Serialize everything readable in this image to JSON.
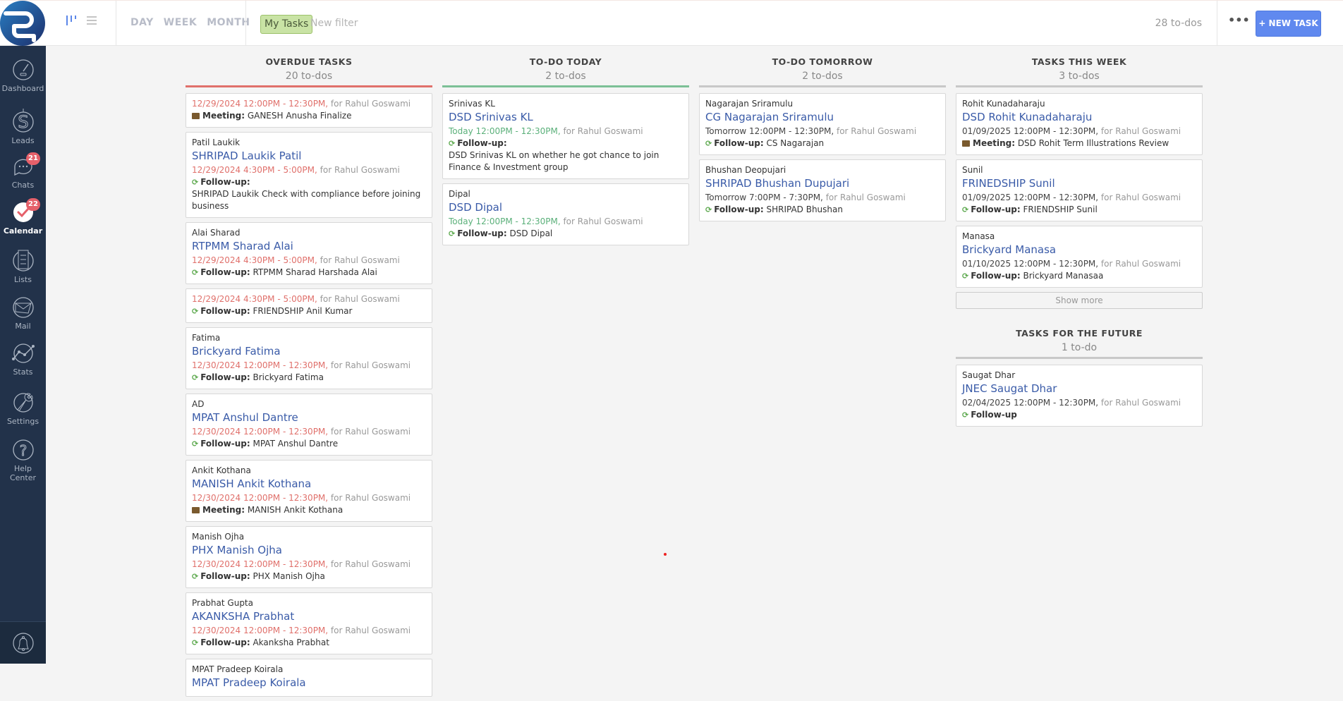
{
  "topbar": {
    "period_tabs": [
      "DAY",
      "WEEK",
      "MONTH"
    ],
    "filter_chip": "My Tasks",
    "new_filter": "New filter",
    "todo_count": "28 to-dos",
    "more_label": "•••",
    "new_task_label": "+ NEW TASK",
    "accent_color": "#6089ef"
  },
  "sidebar": {
    "items": [
      {
        "label": "Dashboard",
        "icon": "dashboard-icon"
      },
      {
        "label": "Leads",
        "icon": "dollar-icon"
      },
      {
        "label": "Chats",
        "icon": "chat-icon",
        "badge": "21"
      },
      {
        "label": "Calendar",
        "icon": "calendar-check-icon",
        "badge": "22",
        "active": true
      },
      {
        "label": "Lists",
        "icon": "list-icon"
      },
      {
        "label": "Mail",
        "icon": "mail-icon"
      },
      {
        "label": "Stats",
        "icon": "stats-icon"
      },
      {
        "label": "Settings",
        "icon": "wrench-icon"
      },
      {
        "label": "Help Center",
        "icon": "help-icon"
      }
    ]
  },
  "columns": [
    {
      "title": "OVERDUE TASKS",
      "count": "20 to-dos",
      "line_color": "#e0706b",
      "status": "overdue",
      "tasks": [
        {
          "contact": "",
          "lead": "",
          "when": "12/29/2024 12:00PM - 12:30PM,",
          "for": " for Rahul Goswami",
          "kind": "meeting",
          "kind_label": "Meeting:",
          "desc": " GANESH Anusha Finalize"
        },
        {
          "contact": "Patil Laukik",
          "lead": "SHRIPAD Laukik Patil",
          "when": "12/29/2024 4:30PM - 5:00PM,",
          "for": " for Rahul Goswami",
          "kind": "follow",
          "kind_label": "Follow-up:",
          "desc": "SHRIPAD Laukik Check with compliance before joining business",
          "desc_block": true
        },
        {
          "contact": "Alai Sharad",
          "lead": "RTPMM Sharad Alai",
          "when": "12/29/2024 4:30PM - 5:00PM,",
          "for": " for Rahul Goswami",
          "kind": "follow",
          "kind_label": "Follow-up:",
          "desc": " RTPMM Sharad Harshada Alai"
        },
        {
          "contact": "",
          "lead": "",
          "when": "12/29/2024 4:30PM - 5:00PM,",
          "for": " for Rahul Goswami",
          "kind": "follow",
          "kind_label": "Follow-up:",
          "desc": " FRIENDSHIP Anil Kumar"
        },
        {
          "contact": "Fatima",
          "lead": "Brickyard Fatima",
          "when": "12/30/2024 12:00PM - 12:30PM,",
          "for": " for Rahul Goswami",
          "kind": "follow",
          "kind_label": "Follow-up:",
          "desc": " Brickyard Fatima"
        },
        {
          "contact": "AD",
          "lead": "MPAT Anshul Dantre",
          "when": "12/30/2024 12:00PM - 12:30PM,",
          "for": " for Rahul Goswami",
          "kind": "follow",
          "kind_label": "Follow-up:",
          "desc": " MPAT Anshul Dantre"
        },
        {
          "contact": "Ankit Kothana",
          "lead": "MANISH Ankit Kothana",
          "when": "12/30/2024 12:00PM - 12:30PM,",
          "for": " for Rahul Goswami",
          "kind": "meeting",
          "kind_label": "Meeting:",
          "desc": " MANISH Ankit Kothana"
        },
        {
          "contact": "Manish Ojha",
          "lead": "PHX Manish Ojha",
          "when": "12/30/2024 12:00PM - 12:30PM,",
          "for": " for Rahul Goswami",
          "kind": "follow",
          "kind_label": "Follow-up:",
          "desc": " PHX Manish Ojha"
        },
        {
          "contact": "Prabhat Gupta",
          "lead": "AKANKSHA Prabhat",
          "when": "12/30/2024 12:00PM - 12:30PM,",
          "for": " for Rahul Goswami",
          "kind": "follow",
          "kind_label": "Follow-up:",
          "desc": " Akanksha Prabhat"
        },
        {
          "contact": "MPAT Pradeep Koirala",
          "lead": "MPAT Pradeep Koirala",
          "when": "",
          "for": "",
          "kind": "",
          "kind_label": "",
          "desc": ""
        }
      ]
    },
    {
      "title": "TO-DO TODAY",
      "count": "2 to-dos",
      "line_color": "#7cc096",
      "status": "today",
      "tasks": [
        {
          "contact": "Srinivas KL",
          "lead": "DSD Srinivas KL",
          "when": "Today 12:00PM - 12:30PM,",
          "for": " for Rahul Goswami",
          "kind": "follow",
          "kind_label": "Follow-up:",
          "desc": "DSD Srinivas KL on whether he got chance to join Finance & Investment group",
          "desc_block": true
        },
        {
          "contact": "Dipal",
          "lead": "DSD Dipal",
          "when": "Today 12:00PM - 12:30PM,",
          "for": " for Rahul Goswami",
          "kind": "follow",
          "kind_label": "Follow-up:",
          "desc": " DSD Dipal"
        }
      ]
    },
    {
      "title": "TO-DO TOMORROW",
      "count": "2 to-dos",
      "line_color": "#c8c8c8",
      "status": "future",
      "tasks": [
        {
          "contact": "Nagarajan Sriramulu",
          "lead": "CG Nagarajan Sriramulu",
          "when": "Tomorrow 12:00PM - 12:30PM,",
          "for": " for Rahul Goswami",
          "kind": "follow",
          "kind_label": "Follow-up:",
          "desc": " CS Nagarajan"
        },
        {
          "contact": "Bhushan Deopujari",
          "lead": "SHRIPAD Bhushan Dupujari",
          "when": "Tomorrow 7:00PM - 7:30PM,",
          "for": " for Rahul Goswami",
          "kind": "follow",
          "kind_label": "Follow-up:",
          "desc": " SHRIPAD Bhushan"
        }
      ]
    },
    {
      "title": "TASKS THIS WEEK",
      "count": "3 to-dos",
      "line_color": "#c8c8c8",
      "status": "future",
      "show_more": "Show more",
      "tasks": [
        {
          "contact": "Rohit Kunadaharaju",
          "lead": "DSD Rohit Kunadaharaju",
          "when": "01/09/2025 12:00PM - 12:30PM,",
          "for": " for Rahul Goswami",
          "kind": "meeting",
          "kind_label": "Meeting:",
          "desc": " DSD Rohit Term Illustrations Review"
        },
        {
          "contact": "Sunil",
          "lead": "FRINEDSHIP Sunil",
          "when": "01/09/2025 12:00PM - 12:30PM,",
          "for": " for Rahul Goswami",
          "kind": "follow",
          "kind_label": "Follow-up:",
          "desc": " FRIENDSHIP Sunil"
        },
        {
          "contact": "Manasa",
          "lead": "Brickyard Manasa",
          "when": "01/10/2025 12:00PM - 12:30PM,",
          "for": " for Rahul Goswami",
          "kind": "follow",
          "kind_label": "Follow-up:",
          "desc": " Brickyard Manasaa"
        }
      ]
    },
    {
      "title": "TASKS FOR THE FUTURE",
      "count": "1 to-do",
      "line_color": "#c8c8c8",
      "status": "future",
      "tasks": [
        {
          "contact": "Saugat Dhar",
          "lead": "JNEC Saugat Dhar",
          "when": "02/04/2025 12:00PM - 12:30PM,",
          "for": " for Rahul Goswami",
          "kind": "follow",
          "kind_label": "Follow-up",
          "desc": ""
        }
      ]
    }
  ]
}
